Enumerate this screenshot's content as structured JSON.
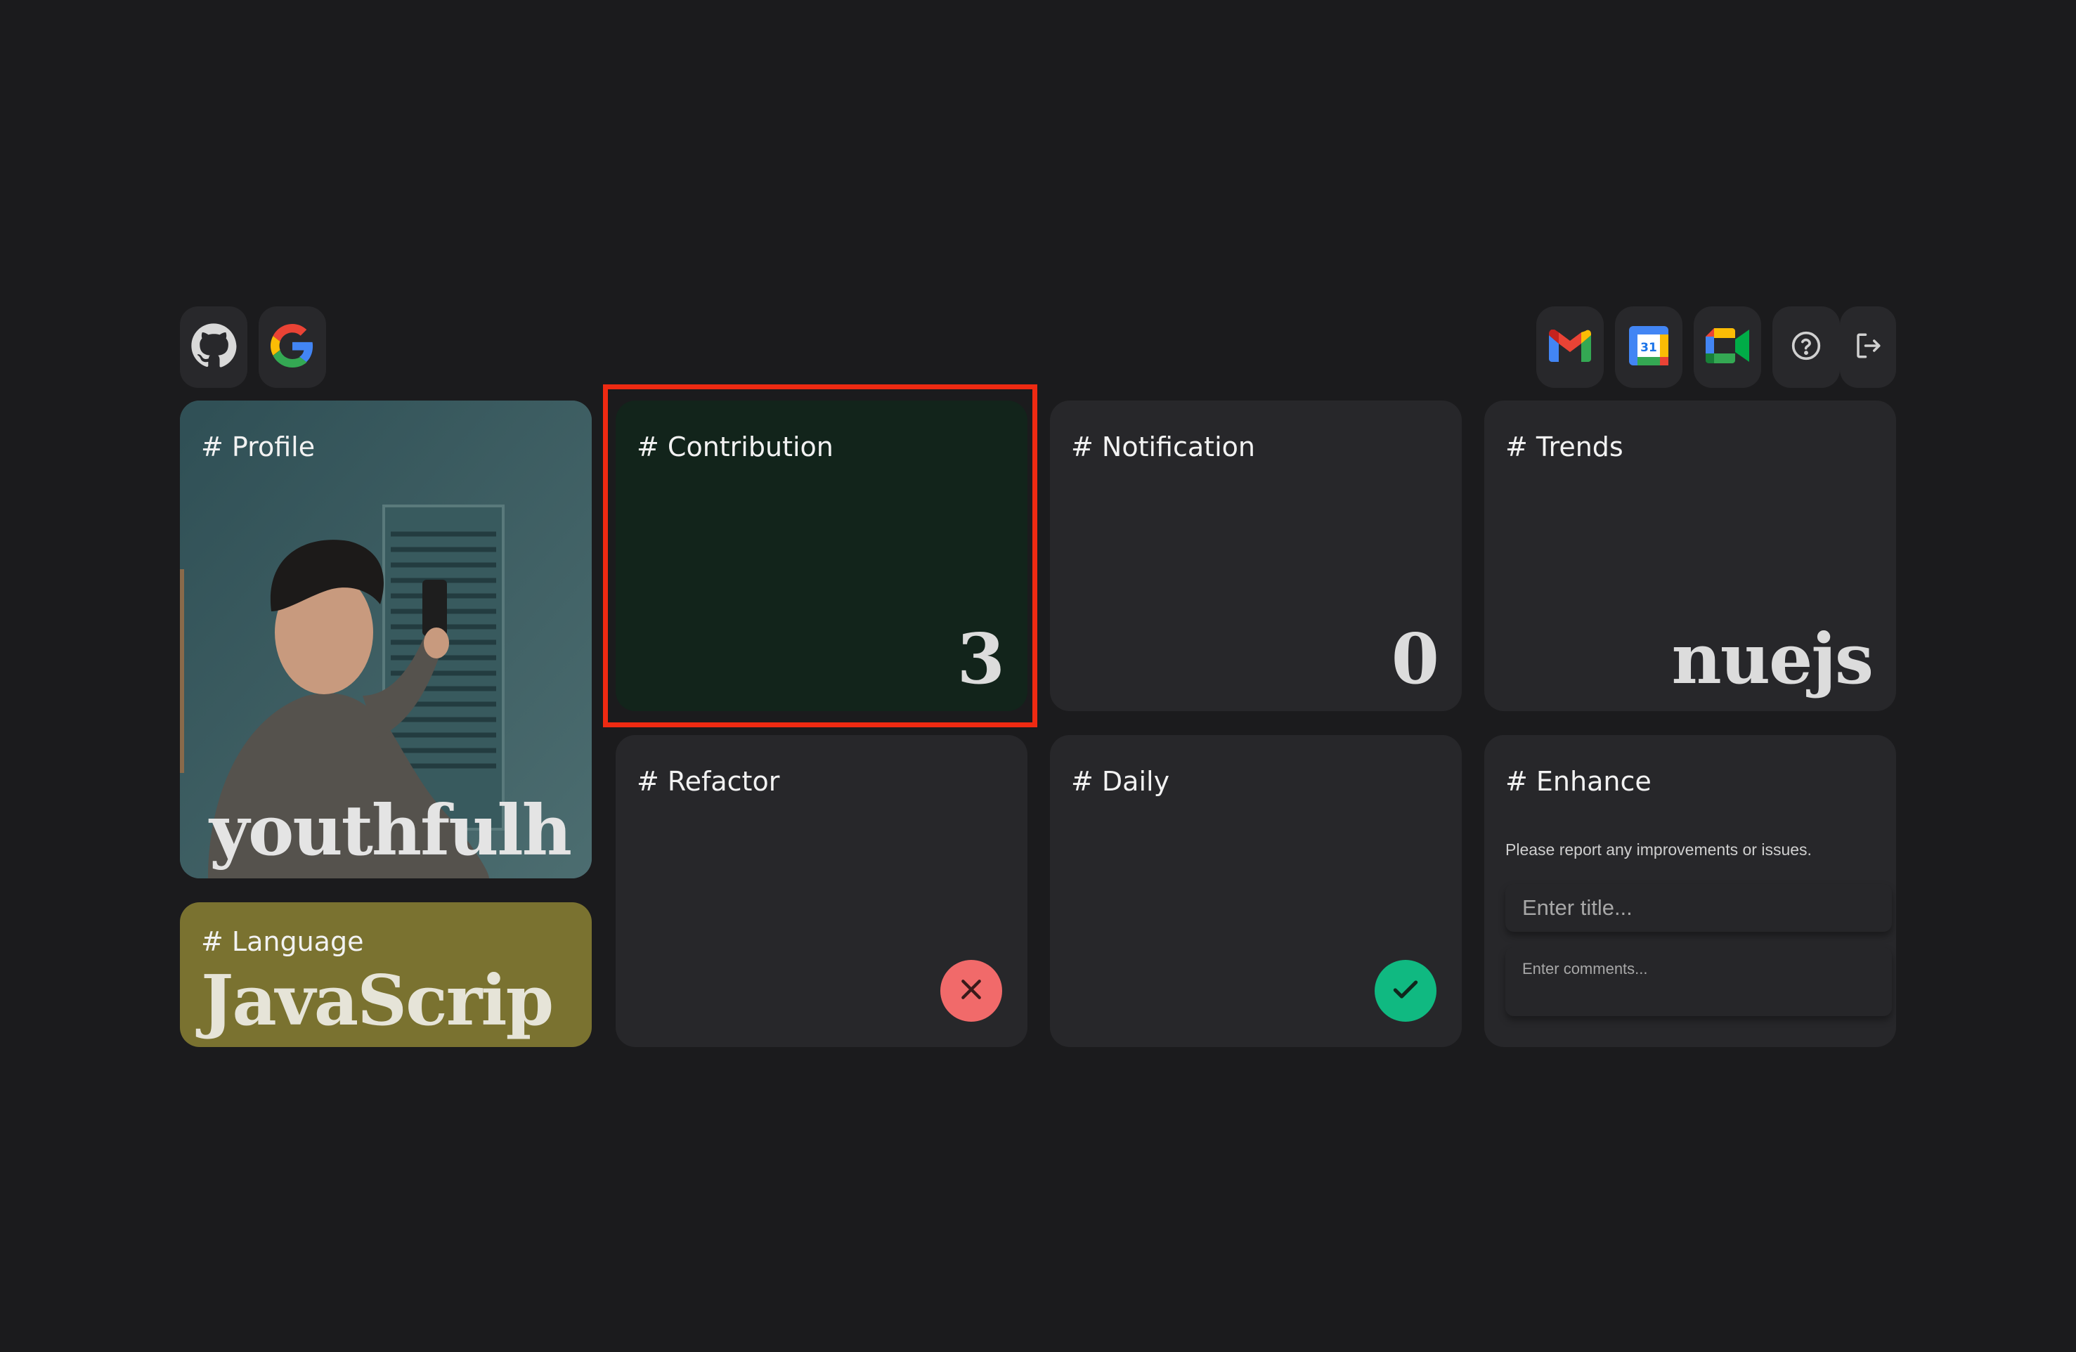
{
  "topbar": {
    "left_icons": [
      "github-icon",
      "google-icon"
    ],
    "right_icons": [
      "gmail-icon",
      "google-calendar-icon",
      "google-meet-icon",
      "help-icon",
      "logout-icon"
    ],
    "calendar_day": "31"
  },
  "cards": {
    "profile": {
      "title": "# Profile",
      "value": "youthfulh"
    },
    "language": {
      "title": "# Language",
      "value": "JavaScrip",
      "color": "#7a7230"
    },
    "contribution": {
      "title": "# Contribution",
      "value": "3",
      "color": "#12241b"
    },
    "notification": {
      "title": "# Notification",
      "value": "0"
    },
    "trends": {
      "title": "# Trends",
      "value": "nuejs"
    },
    "refactor": {
      "title": "# Refactor",
      "status": "x-icon",
      "status_color": "#f16a6a"
    },
    "daily": {
      "title": "# Daily",
      "status": "check-icon",
      "status_color": "#10b981"
    },
    "enhance": {
      "title": "# Enhance",
      "description": "Please report any improvements or issues.",
      "title_placeholder": "Enter title...",
      "comments_placeholder": "Enter comments..."
    }
  },
  "highlight_color": "#ee2a12"
}
